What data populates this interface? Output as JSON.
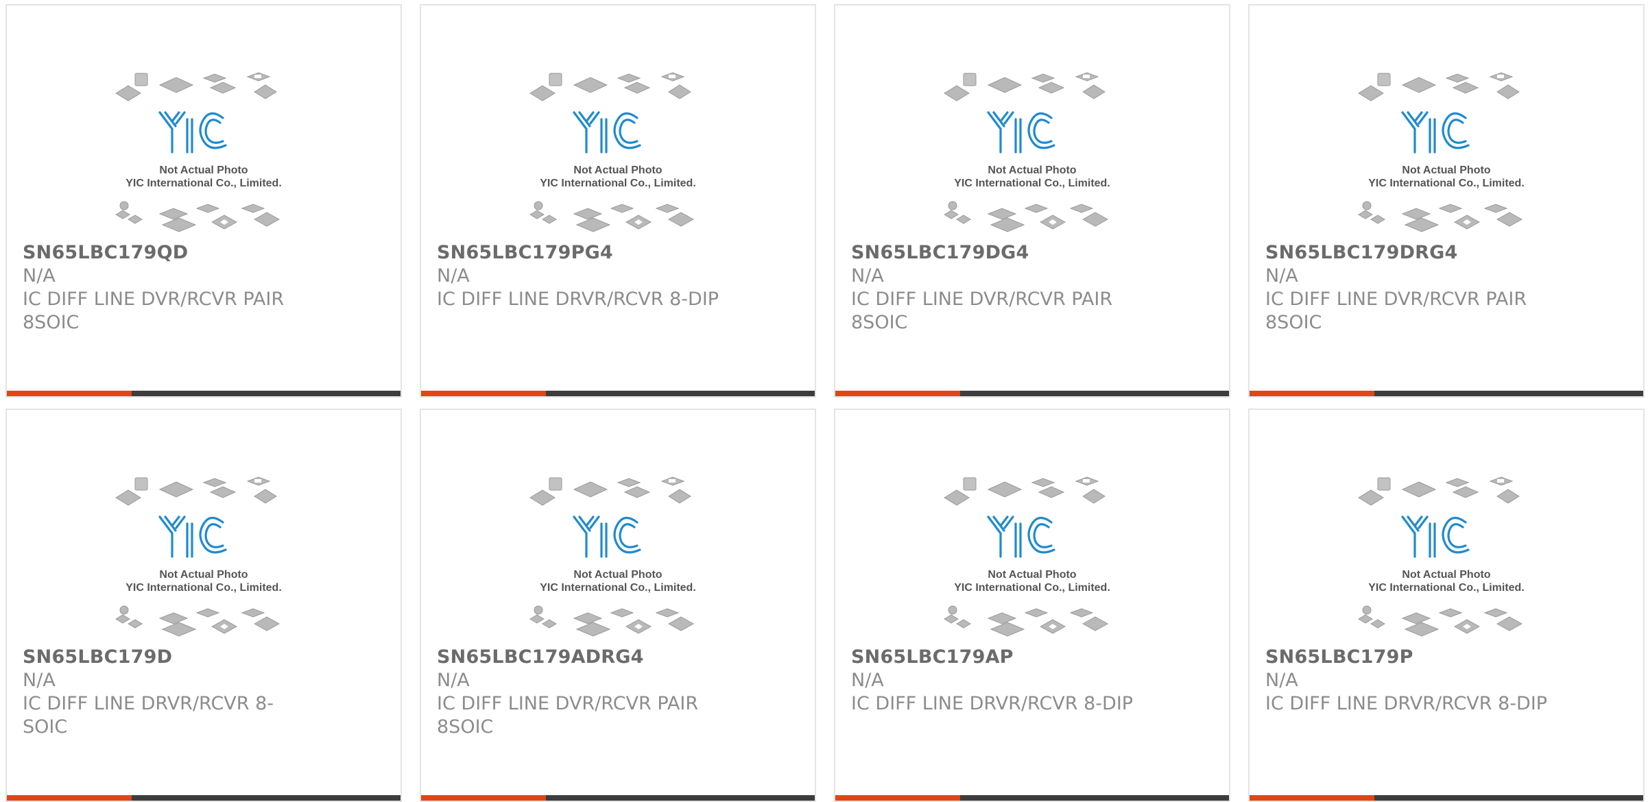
{
  "colors": {
    "accent": "#e04616",
    "bar_dark": "#3d3d3d",
    "logo_blue": "#1f8ad0",
    "text_grey": "#8c8c8c"
  },
  "placeholder": {
    "line1": "Not Actual Photo",
    "line2": "YIC International Co., Limited.",
    "logo_text": "YIC",
    "icon": "ic-chips-placeholder-image"
  },
  "products": [
    {
      "part_number": "SN65LBC179QD",
      "manufacturer": "N/A",
      "description": "IC DIFF LINE DVR/RCVR PAIR 8SOIC"
    },
    {
      "part_number": "SN65LBC179PG4",
      "manufacturer": "N/A",
      "description": "IC DIFF LINE DRVR/RCVR 8-DIP"
    },
    {
      "part_number": "SN65LBC179DG4",
      "manufacturer": "N/A",
      "description": "IC DIFF LINE DVR/RCVR PAIR 8SOIC"
    },
    {
      "part_number": "SN65LBC179DRG4",
      "manufacturer": "N/A",
      "description": "IC DIFF LINE DVR/RCVR PAIR 8SOIC"
    },
    {
      "part_number": "SN65LBC179D",
      "manufacturer": "N/A",
      "description": "IC DIFF LINE DRVR/RCVR 8-SOIC"
    },
    {
      "part_number": "SN65LBC179ADRG4",
      "manufacturer": "N/A",
      "description": "IC DIFF LINE DVR/RCVR PAIR 8SOIC"
    },
    {
      "part_number": "SN65LBC179AP",
      "manufacturer": "N/A",
      "description": "IC DIFF LINE DRVR/RCVR 8-DIP"
    },
    {
      "part_number": "SN65LBC179P",
      "manufacturer": "N/A",
      "description": "IC DIFF LINE DRVR/RCVR 8-DIP"
    }
  ]
}
